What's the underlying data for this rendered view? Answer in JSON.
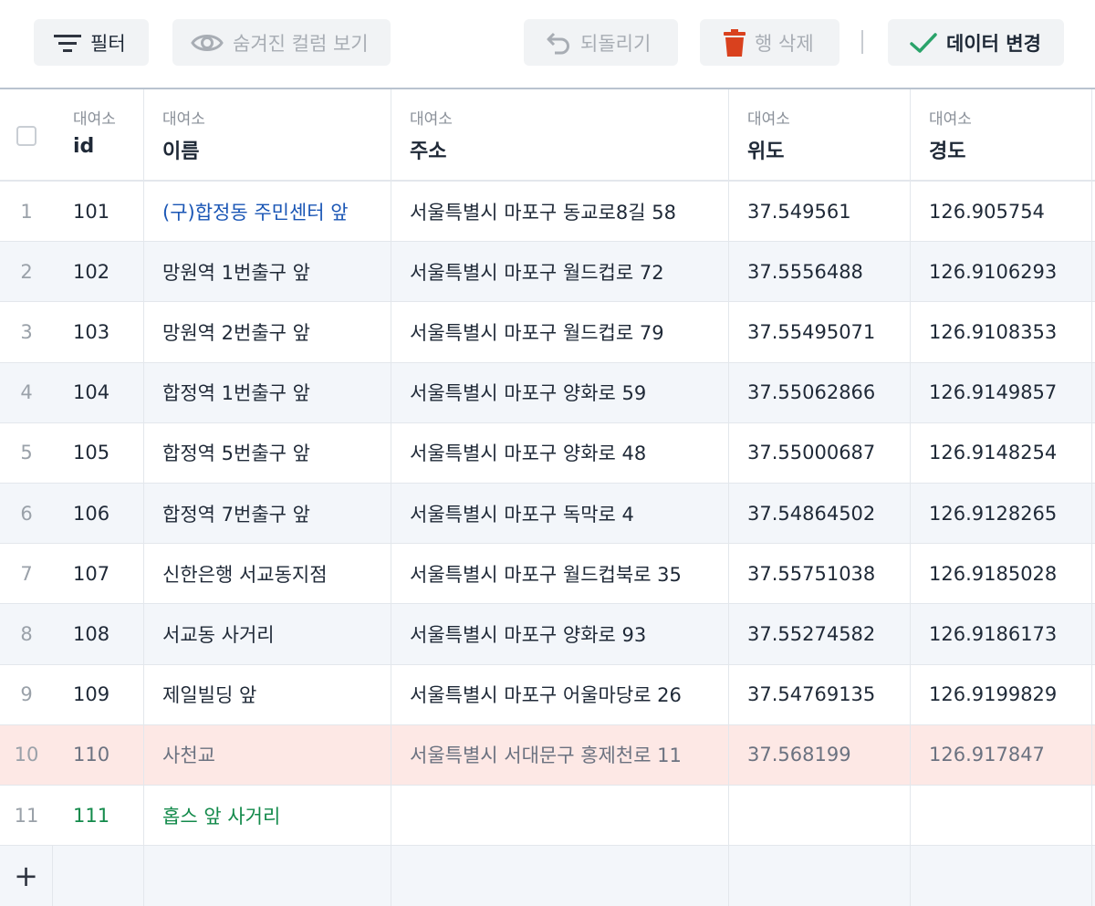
{
  "toolbar": {
    "filter": "필터",
    "hidden_columns": "숨겨진 컬럼 보기",
    "undo": "되돌리기",
    "delete_row": "행 삭제",
    "apply": "데이터 변경",
    "colors": {
      "delete_icon": "#d9411e",
      "apply_icon": "#2aa36a",
      "link": "#1a56b5",
      "new": "#138a4b",
      "deleted_row": "#fde8e5"
    }
  },
  "header": {
    "columns": [
      {
        "group": "대여소",
        "name": "id"
      },
      {
        "group": "대여소",
        "name": "이름"
      },
      {
        "group": "대여소",
        "name": "주소"
      },
      {
        "group": "대여소",
        "name": "위도"
      },
      {
        "group": "대여소",
        "name": "경도"
      }
    ]
  },
  "rows": [
    {
      "num": "1",
      "id": "101",
      "name": "(구)합정동 주민센터 앞",
      "addr": "서울특별시 마포구 동교로8길 58",
      "lat": "37.549561",
      "lng": "126.905754",
      "state": "edited-link"
    },
    {
      "num": "2",
      "id": "102",
      "name": "망원역 1번출구 앞",
      "addr": "서울특별시 마포구 월드컵로 72",
      "lat": "37.5556488",
      "lng": "126.9106293",
      "state": "normal"
    },
    {
      "num": "3",
      "id": "103",
      "name": "망원역 2번출구 앞",
      "addr": "서울특별시 마포구 월드컵로 79",
      "lat": "37.55495071",
      "lng": "126.9108353",
      "state": "normal"
    },
    {
      "num": "4",
      "id": "104",
      "name": "합정역 1번출구 앞",
      "addr": "서울특별시 마포구 양화로 59",
      "lat": "37.55062866",
      "lng": "126.9149857",
      "state": "normal"
    },
    {
      "num": "5",
      "id": "105",
      "name": "합정역 5번출구 앞",
      "addr": "서울특별시 마포구 양화로 48",
      "lat": "37.55000687",
      "lng": "126.9148254",
      "state": "normal"
    },
    {
      "num": "6",
      "id": "106",
      "name": "합정역 7번출구 앞",
      "addr": "서울특별시 마포구 독막로 4",
      "lat": "37.54864502",
      "lng": "126.9128265",
      "state": "normal"
    },
    {
      "num": "7",
      "id": "107",
      "name": "신한은행 서교동지점",
      "addr": "서울특별시 마포구 월드컵북로 35",
      "lat": "37.55751038",
      "lng": "126.9185028",
      "state": "normal"
    },
    {
      "num": "8",
      "id": "108",
      "name": "서교동 사거리",
      "addr": "서울특별시 마포구 양화로 93",
      "lat": "37.55274582",
      "lng": "126.9186173",
      "state": "normal"
    },
    {
      "num": "9",
      "id": "109",
      "name": "제일빌딩 앞",
      "addr": "서울특별시 마포구 어울마당로 26",
      "lat": "37.54769135",
      "lng": "126.9199829",
      "state": "normal"
    },
    {
      "num": "10",
      "id": "110",
      "name": "사천교",
      "addr": "서울특별시 서대문구 홍제천로 11",
      "lat": "37.568199",
      "lng": "126.917847",
      "state": "deleted"
    },
    {
      "num": "11",
      "id": "111",
      "name": "홉스 앞 사거리",
      "addr": "",
      "lat": "",
      "lng": "",
      "state": "new"
    }
  ],
  "add_row": {
    "label": "+"
  }
}
